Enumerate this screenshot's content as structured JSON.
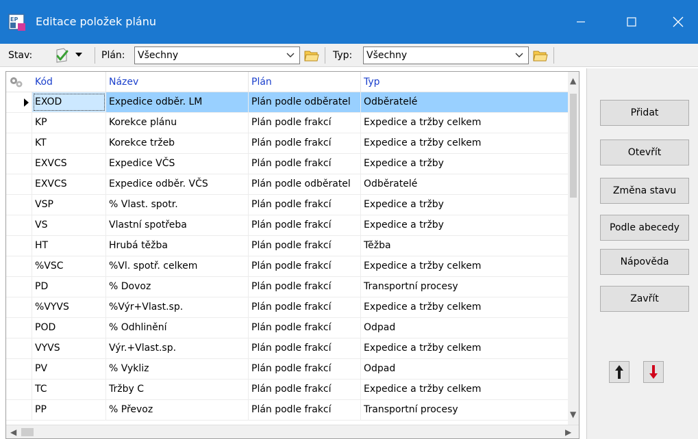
{
  "window": {
    "title": "Editace položek plánu",
    "titlebar_color": "#1b78d0"
  },
  "toolbar": {
    "stav_label": "Stav:",
    "plan_label": "Plán:",
    "plan_value": "Všechny",
    "typ_label": "Typ:",
    "typ_value": "Všechny"
  },
  "grid": {
    "columns": [
      "Kód",
      "Název",
      "Plán",
      "Typ"
    ],
    "header_color": "#1a3fcc",
    "selected_row": 0,
    "rows": [
      {
        "code": "EXOD",
        "name": "Expedice odběr. LM",
        "plan": "Plán podle odběratel",
        "type": "Odběratelé"
      },
      {
        "code": "KP",
        "name": "Korekce plánu",
        "plan": "Plán podle frakcí",
        "type": "Expedice a tržby celkem"
      },
      {
        "code": "KT",
        "name": "Korekce tržeb",
        "plan": "Plán podle frakcí",
        "type": "Expedice a tržby celkem"
      },
      {
        "code": "EXVCS",
        "name": "Expedice VČS",
        "plan": "Plán podle frakcí",
        "type": "Expedice a tržby"
      },
      {
        "code": "EXVCS",
        "name": "Expedice odběr. VČS",
        "plan": "Plán podle odběratel",
        "type": "Odběratelé"
      },
      {
        "code": "VSP",
        "name": "% Vlast. spotr.",
        "plan": "Plán podle frakcí",
        "type": "Expedice a tržby"
      },
      {
        "code": "VS",
        "name": "Vlastní spotřeba",
        "plan": "Plán podle frakcí",
        "type": "Expedice a tržby"
      },
      {
        "code": "HT",
        "name": "Hrubá těžba",
        "plan": "Plán podle frakcí",
        "type": "Těžba"
      },
      {
        "code": "%VSC",
        "name": "%Vl. spotř. celkem",
        "plan": "Plán podle frakcí",
        "type": "Expedice a tržby celkem"
      },
      {
        "code": "PD",
        "name": "% Dovoz",
        "plan": "Plán podle frakcí",
        "type": "Transportní procesy"
      },
      {
        "code": "%VYVS",
        "name": "%Výr+Vlast.sp.",
        "plan": "Plán podle frakcí",
        "type": "Expedice a tržby celkem"
      },
      {
        "code": "POD",
        "name": "% Odhlinění",
        "plan": "Plán podle frakcí",
        "type": "Odpad"
      },
      {
        "code": "VYVS",
        "name": "Výr.+Vlast.sp.",
        "plan": "Plán podle frakcí",
        "type": "Expedice a tržby celkem"
      },
      {
        "code": "PV",
        "name": "% Vykliz",
        "plan": "Plán podle frakcí",
        "type": "Odpad"
      },
      {
        "code": "TC",
        "name": "Tržby C",
        "plan": "Plán podle frakcí",
        "type": "Expedice a tržby celkem"
      },
      {
        "code": "PP",
        "name": "% Převoz",
        "plan": "Plán podle frakcí",
        "type": "Transportní procesy"
      }
    ]
  },
  "panel": {
    "buttons": [
      {
        "label": "Přidat",
        "name": "add-button"
      },
      {
        "label": "Otevřít",
        "name": "open-button"
      },
      {
        "label": "Změna stavu",
        "name": "change-state-button"
      },
      {
        "label": "Podle abecedy",
        "name": "sort-alphabetically-button"
      },
      {
        "label": "Nápověda",
        "name": "help-button"
      },
      {
        "label": "Zavřít",
        "name": "close-dialog-button"
      }
    ],
    "arrow_up_icon": "arrow-up-icon",
    "arrow_down_icon": "arrow-down-icon",
    "arrow_up_color": "#1a1a1a",
    "arrow_down_color": "#d0021b"
  }
}
